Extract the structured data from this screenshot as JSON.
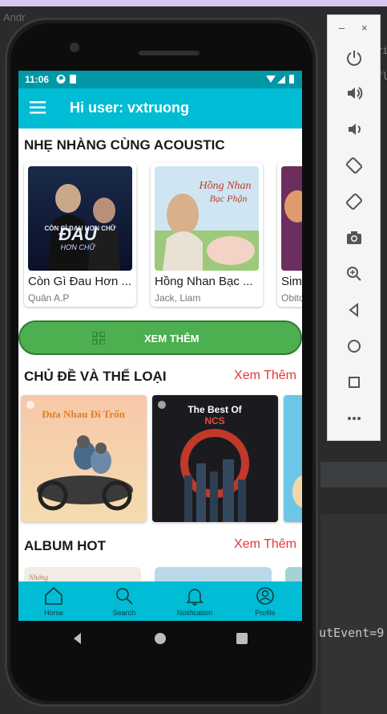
{
  "ide": {
    "title_fragment": "Andr",
    "code_fragment": "utEvent=9",
    "peek_1": "ri",
    "peek_2": "fl"
  },
  "emulator_toolbar": {
    "minimize": "–",
    "close": "×",
    "buttons": [
      "power-icon",
      "volume-up-icon",
      "volume-down-icon",
      "rotate-left-icon",
      "rotate-right-icon",
      "camera-icon",
      "zoom-icon",
      "back-icon",
      "home-icon",
      "overview-icon",
      "more-icon"
    ]
  },
  "status_bar": {
    "time": "11:06"
  },
  "app_bar": {
    "title": "Hi user: vxtruong"
  },
  "section_acoustic": {
    "title": "NHẸ NHÀNG CÙNG ACOUSTIC",
    "cards": [
      {
        "title": "Còn Gì Đau Hơn ...",
        "artist": "Quân A.P",
        "art_text": "CÒN GÌ ĐAU HƠN CHỮ"
      },
      {
        "title": "Hồng Nhan Bạc ...",
        "artist": "Jack, Liam",
        "art_text": "Hồng Nhan Bạc Phận"
      },
      {
        "title": "Sim",
        "artist": "Obito"
      }
    ]
  },
  "xem_them_button": {
    "label": "XEM THÊM"
  },
  "section_topics": {
    "title": "CHỦ ĐỀ VÀ THỂ LOẠI",
    "see_more": "Xem Thêm",
    "cards": [
      {
        "art_text": "Đưa Nhau Đi Trốn"
      },
      {
        "art_text_1": "The Best Of",
        "art_text_2": "NCS"
      }
    ]
  },
  "section_album": {
    "title": "ALBUM HOT",
    "see_more": "Xem Thêm"
  },
  "bottom_nav": {
    "items": [
      {
        "label": "Home",
        "icon": "home-icon"
      },
      {
        "label": "Search",
        "icon": "search-icon"
      },
      {
        "label": "Notification",
        "icon": "bell-icon"
      },
      {
        "label": "Profile",
        "icon": "profile-icon"
      }
    ]
  },
  "colors": {
    "app_bar": "#00bcd4",
    "status_bar": "#0097a7",
    "button_green": "#4caf50",
    "link_red": "#e53935"
  }
}
